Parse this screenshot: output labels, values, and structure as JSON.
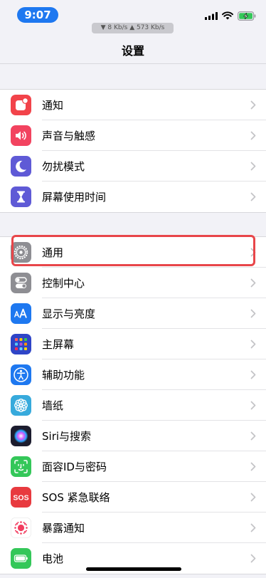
{
  "status_bar": {
    "time": "9:07",
    "network_speed": "▼ 8 Kb/s    ▲ 573 Kb/s"
  },
  "nav": {
    "title": "设置"
  },
  "groups": [
    {
      "items": [
        {
          "label": "通知",
          "icon": "notification-icon",
          "color": "#f2434a"
        },
        {
          "label": "声音与触感",
          "icon": "sound-icon",
          "color": "#f2435f"
        },
        {
          "label": "勿扰模式",
          "icon": "moon-icon",
          "color": "#5f5ad6"
        },
        {
          "label": "屏幕使用时间",
          "icon": "hourglass-icon",
          "color": "#5f5ad6"
        }
      ]
    },
    {
      "items": [
        {
          "label": "通用",
          "icon": "gear-icon",
          "color": "#8e8e93"
        },
        {
          "label": "控制中心",
          "icon": "toggles-icon",
          "color": "#8e8e93"
        },
        {
          "label": "显示与亮度",
          "icon": "text-size-icon",
          "color": "#1e78f0"
        },
        {
          "label": "主屏幕",
          "icon": "home-grid-icon",
          "color": "#2f45c7"
        },
        {
          "label": "辅助功能",
          "icon": "accessibility-icon",
          "color": "#1e78f0"
        },
        {
          "label": "墙纸",
          "icon": "flower-icon",
          "color": "#37aadc"
        },
        {
          "label": "Siri与搜索",
          "icon": "siri-icon",
          "color": "#1c1c2e"
        },
        {
          "label": "面容ID与密码",
          "icon": "face-id-icon",
          "color": "#34c759"
        },
        {
          "label": "SOS 紧急联络",
          "icon": "sos-icon",
          "color": "#e83a3f"
        },
        {
          "label": "暴露通知",
          "icon": "exposure-icon",
          "color": "#ffffff"
        },
        {
          "label": "电池",
          "icon": "battery-icon",
          "color": "#34c759"
        }
      ]
    }
  ]
}
